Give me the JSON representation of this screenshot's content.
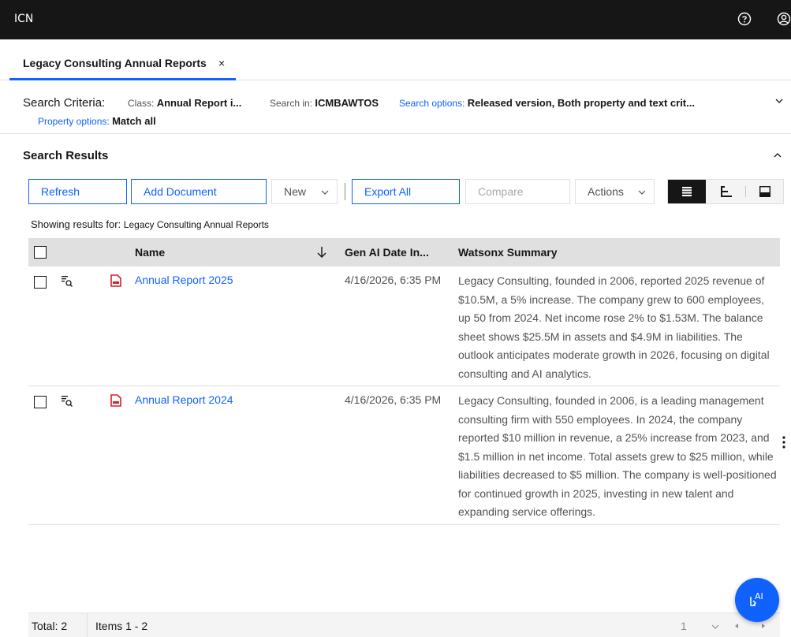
{
  "header": {
    "app_name": "ICN"
  },
  "tab": {
    "label": "Legacy Consulting Annual Reports",
    "close": "×"
  },
  "criteria": {
    "title": "Search Criteria:",
    "class_label": "Class:",
    "class_value": "Annual Report i...",
    "search_in_label": "Search in:",
    "search_in_value": "ICMBAWTOS",
    "search_options_label": "Search options:",
    "search_options_value": "Released version, Both property and text crit...",
    "property_options_label": "Property options:",
    "property_options_value": "Match all"
  },
  "results": {
    "title": "Search Results",
    "showing_prefix": "Showing results for:",
    "showing_query": "Legacy Consulting Annual Reports"
  },
  "toolbar": {
    "refresh": "Refresh",
    "add_document": "Add Document",
    "new": "New",
    "export_all": "Export All",
    "compare": "Compare",
    "actions": "Actions"
  },
  "table": {
    "columns": {
      "name": "Name",
      "date": "Gen AI Date In...",
      "summary": "Watsonx Summary"
    },
    "rows": [
      {
        "name": "Annual Report 2025",
        "date": "4/16/2026, 6:35 PM",
        "summary": "Legacy Consulting, founded in 2006, reported 2025 revenue of $10.5M, a 5% increase. The company grew to 600 employees, up 50 from 2024. Net income rose 2% to $1.53M. The balance sheet shows $25.5M in assets and $4.9M in liabilities. The outlook anticipates moderate growth in 2026, focusing on digital consulting and AI analytics."
      },
      {
        "name": "Annual Report 2024",
        "date": "4/16/2026, 6:35 PM",
        "summary": "Legacy Consulting, founded in 2006, is a leading management consulting firm with 550 employees. In 2024, the company reported $10 million in revenue, a 25% increase from 2023, and $1.5 million in net income. Total assets grew to $25 million, while liabilities decreased to $5 million. The company is well-positioned for continued growth in 2025, investing in new talent and expanding service offerings."
      }
    ]
  },
  "footer": {
    "total": "Total: 2",
    "items": "Items 1 - 2",
    "page": "1"
  },
  "ai_button": {
    "label": "AI"
  },
  "colors": {
    "accent": "#0f62fe",
    "header_bg": "#161616",
    "pdf_red": "#da1e28"
  }
}
